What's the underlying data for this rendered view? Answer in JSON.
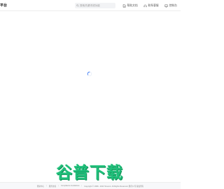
{
  "header": {
    "brand": "平台",
    "search": {
      "placeholder": "搜索关键词或功能"
    },
    "links": {
      "docs": "帮助文档",
      "support": "联系客服",
      "console": "控制台"
    }
  },
  "main": {
    "loading": true
  },
  "footer": {
    "items": [
      "帮助中心",
      "服务协议",
      "Compliance Guidelines",
      "Copyright © 1998 - 2023 Tencent. All Rights Reserved. 腾讯公司 版权所有"
    ]
  },
  "watermark": {
    "text": "谷普下载"
  },
  "colors": {
    "accent": "#2a6ef5",
    "watermark": "#1fbf7a"
  }
}
